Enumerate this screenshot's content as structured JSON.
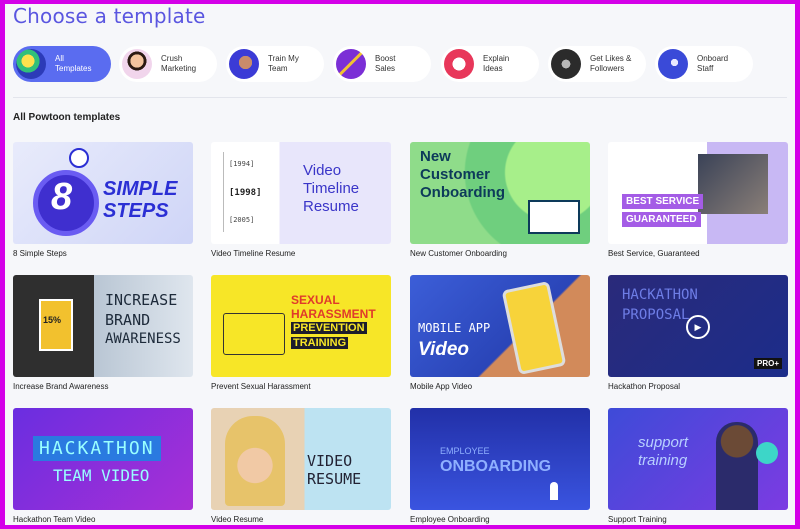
{
  "page_title": "Choose a template",
  "section_title": "All Powtoon templates",
  "categories": [
    {
      "label": "All\nTemplates",
      "active": true
    },
    {
      "label": "Crush\nMarketing",
      "active": false
    },
    {
      "label": "Train My\nTeam",
      "active": false
    },
    {
      "label": "Boost\nSales",
      "active": false
    },
    {
      "label": "Explain\nIdeas",
      "active": false
    },
    {
      "label": "Get Likes &\nFollowers",
      "active": false
    },
    {
      "label": "Onboard\nStaff",
      "active": false
    }
  ],
  "templates": [
    {
      "title": "8 Simple Steps",
      "thumb_lines": [
        "8",
        "SIMPLE",
        "STEPS"
      ]
    },
    {
      "title": "Video Timeline Resume",
      "thumb_lines": [
        "Video",
        "Timeline",
        "Resume"
      ],
      "years": [
        "[1994]",
        "[1998]",
        "[2005]"
      ]
    },
    {
      "title": "New Customer Onboarding",
      "thumb_lines": [
        "New",
        "Customer",
        "Onboarding"
      ]
    },
    {
      "title": "Best Service, Guaranteed",
      "thumb_lines": [
        "BEST SERVICE",
        "GUARANTEED"
      ]
    },
    {
      "title": "Increase Brand Awareness",
      "thumb_lines": [
        "INCREASE",
        "BRAND",
        "AWARENESS"
      ],
      "percent": "15%"
    },
    {
      "title": "Prevent Sexual Harassment",
      "thumb_lines": [
        "SEXUAL",
        "HARASSMENT",
        "PREVENTION",
        "TRAINING"
      ]
    },
    {
      "title": "Mobile App Video",
      "thumb_lines": [
        "MOBILE APP",
        "Video"
      ]
    },
    {
      "title": "Hackathon Proposal",
      "thumb_lines": [
        "HACKATHON",
        "PROPOSAL"
      ],
      "badge": "PRO+"
    },
    {
      "title": "Hackathon Team Video",
      "thumb_lines": [
        "HACKATHON",
        "TEAM VIDEO"
      ]
    },
    {
      "title": "Video Resume",
      "thumb_lines": [
        "VIDEO",
        "RESUME"
      ]
    },
    {
      "title": "Employee Onboarding",
      "thumb_lines": [
        "EMPLOYEE",
        "ONBOARDING"
      ]
    },
    {
      "title": "Support Training",
      "thumb_lines": [
        "support",
        "training"
      ]
    }
  ],
  "colors": {
    "border": "#d400e8",
    "accent": "#5a6cf0",
    "title": "#5a56e0",
    "background": "#f6f7fa"
  }
}
